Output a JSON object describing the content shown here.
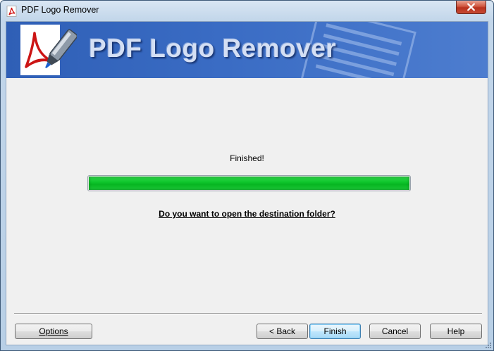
{
  "window": {
    "title": "PDF Logo Remover",
    "close_icon": "close-icon"
  },
  "banner": {
    "title": "PDF Logo Remover",
    "logo_icon": "pdf-pen-logo-icon"
  },
  "main": {
    "status": "Finished!",
    "progress_percent": 100,
    "open_folder_link": "Do you want to open the destination folder?"
  },
  "footer": {
    "options_label": "Options",
    "back_label": "< Back",
    "finish_label": "Finish",
    "cancel_label": "Cancel",
    "help_label": "Help"
  },
  "colors": {
    "banner": "#3a6cc4",
    "progress": "#06c425",
    "close_button": "#c7432c"
  }
}
